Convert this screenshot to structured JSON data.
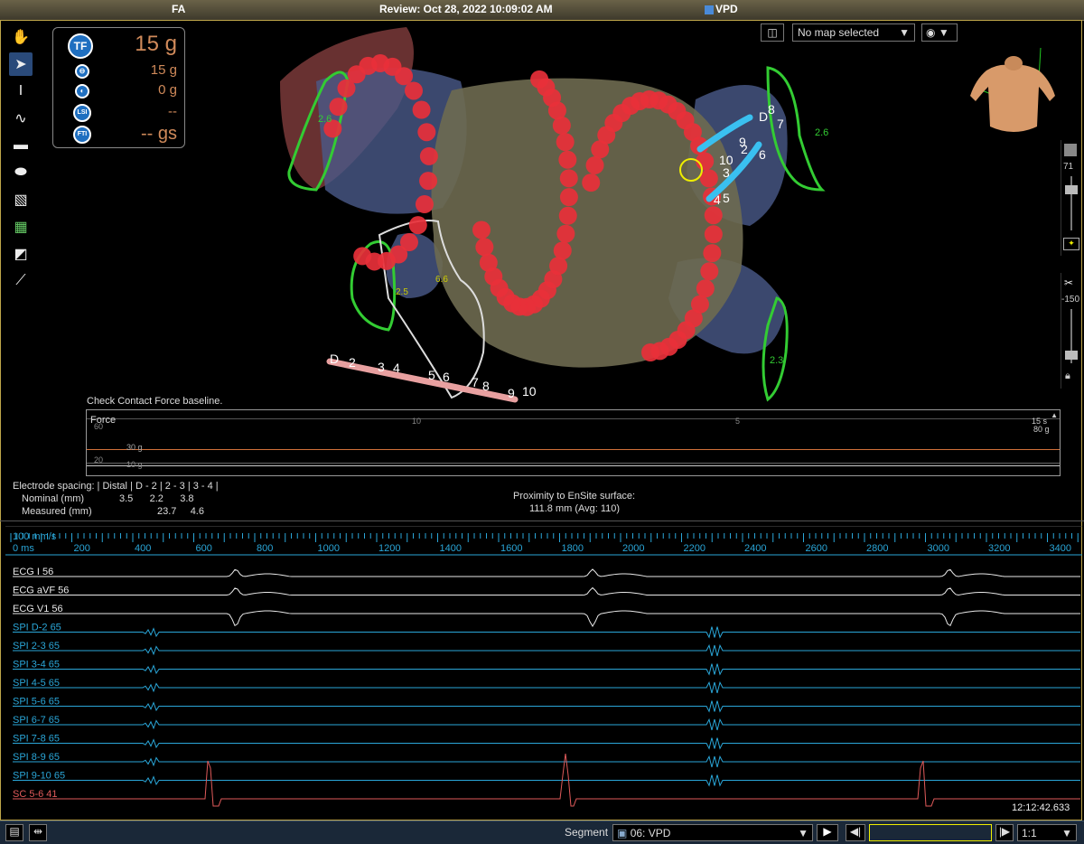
{
  "title_bar": {
    "left": "FA",
    "center": "Review: Oct 28, 2022 10:09:02 AM",
    "right": "VPD"
  },
  "toolbar": {
    "tools": [
      "hand-icon",
      "pointer-icon",
      "text-cursor-icon",
      "curve-icon",
      "ruler-icon",
      "ellipse-icon",
      "eraser-icon",
      "grid-icon",
      "lasso-icon",
      "catheter-icon"
    ]
  },
  "contact_force": {
    "tf_badge": "TF",
    "tf_value": "15 g",
    "lateral_value": "15 g",
    "axial_value": "0 g",
    "lsi_badge": "LSI",
    "lsi_value": "--",
    "fti_badge": "FTI",
    "fti_value": "-- gs"
  },
  "map_controls": {
    "map_select": "No map selected"
  },
  "slider_top": {
    "value": "71"
  },
  "slider_mid": {
    "value": "-150"
  },
  "map_labels": {
    "left_top": "2.6",
    "right_top": "2.6",
    "center_left_a": "2.5",
    "center_left_b": "6.6",
    "bottom_right": "2.3"
  },
  "catheter_spiral_labels": [
    "D",
    "8",
    "7",
    "9",
    "2",
    "10",
    "3",
    "6",
    "4",
    "5"
  ],
  "catheter_bottom_labels": [
    "D",
    "2",
    "3",
    "4",
    "5",
    "6",
    "7",
    "8",
    "9",
    "10"
  ],
  "force_graph": {
    "message": "Check Contact Force baseline.",
    "title": "Force",
    "axis_labels": [
      "60",
      "10",
      "5",
      "15 s"
    ],
    "right_label": "80 g",
    "line_30": "30 g",
    "line_20": "20",
    "line_10": "10 g"
  },
  "electrode_spacing": {
    "header": "Electrode spacing: | Distal | D - 2 | 2 - 3 | 3 - 4 |",
    "nominal_label": "Nominal (mm)",
    "nominal_values": "3.5      2.2      3.8",
    "measured_label": "Measured (mm)",
    "measured_values": "23.7     4.6"
  },
  "proximity": {
    "label": "Proximity to EnSite surface:",
    "value": "111.8 mm (Avg: 110)"
  },
  "timeline": {
    "speed": "100 mm/s",
    "ticks": [
      "0 ms",
      "200",
      "400",
      "600",
      "800",
      "1000",
      "1200",
      "1400",
      "1600",
      "1800",
      "2000",
      "2200",
      "2400",
      "2600",
      "2800",
      "3000",
      "3200",
      "3400"
    ]
  },
  "channels": [
    {
      "name": "ECG I 56",
      "color": "#e8e8e8"
    },
    {
      "name": "ECG aVF 56",
      "color": "#e8e8e8"
    },
    {
      "name": "ECG V1 56",
      "color": "#e8e8e8"
    },
    {
      "name": "SPI  D-2 65",
      "color": "#2aa6d8"
    },
    {
      "name": "SPI  2-3 65",
      "color": "#2aa6d8"
    },
    {
      "name": "SPI  3-4 65",
      "color": "#2aa6d8"
    },
    {
      "name": "SPI  4-5 65",
      "color": "#2aa6d8"
    },
    {
      "name": "SPI  5-6 65",
      "color": "#2aa6d8"
    },
    {
      "name": "SPI  6-7 65",
      "color": "#2aa6d8"
    },
    {
      "name": "SPI  7-8 65",
      "color": "#2aa6d8"
    },
    {
      "name": "SPI  8-9 65",
      "color": "#2aa6d8"
    },
    {
      "name": "SPI  9-10 65",
      "color": "#2aa6d8"
    },
    {
      "name": "SC  5-6 41",
      "color": "#e05a5a"
    }
  ],
  "clock": "12:12:42.633",
  "bottom_bar": {
    "segment_label": "Segment",
    "segment_value": "06: VPD",
    "ratio": "1:1"
  }
}
